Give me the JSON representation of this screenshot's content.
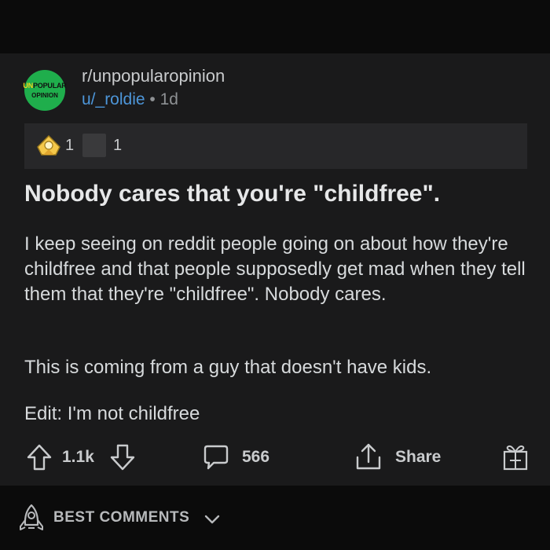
{
  "post": {
    "subreddit": "r/unpopularopinion",
    "avatar_text_un": "UN",
    "avatar_text_popular": "POPULAR",
    "avatar_text_opinion": "OPINION",
    "author": "u/_roldie",
    "separator": "•",
    "age": "1d",
    "awards": [
      {
        "icon": "helpful-award-icon",
        "count": "1"
      },
      {
        "icon": "award-placeholder",
        "count": "1"
      }
    ],
    "title": "Nobody cares that you're \"childfree\".",
    "body": [
      "I keep seeing on reddit people going on about how they're childfree and that people supposedly get mad when they tell them that they're \"childfree\". Nobody cares.",
      "This is coming from a guy that doesn't have kids.",
      "Edit: I'm not childfree"
    ],
    "actions": {
      "upvote_icon": "upvote-arrow-icon",
      "score": "1.1k",
      "downvote_icon": "downvote-arrow-icon",
      "comment_icon": "comment-bubble-icon",
      "comments": "566",
      "share_icon": "share-icon",
      "share_label": "Share",
      "gift_icon": "gift-award-icon"
    }
  },
  "footer": {
    "sort_icon": "rocket-icon",
    "sort_label": "BEST COMMENTS",
    "chevron_icon": "chevron-down-icon"
  },
  "colors": {
    "background": "#0b0b0b",
    "card": "#1a1a1b",
    "award_bar": "#272729",
    "accent_user": "#4d96d9",
    "avatar_green": "#1fae4c"
  }
}
